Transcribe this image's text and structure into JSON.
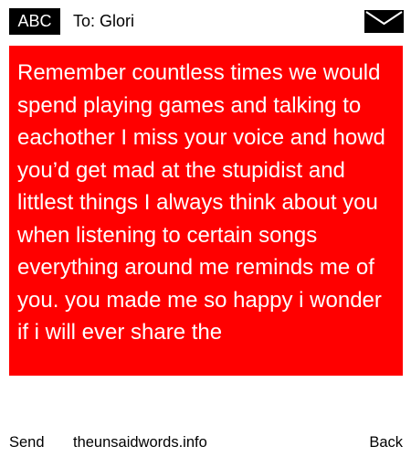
{
  "header": {
    "badge_label": "ABC",
    "recipient": "To: Glori",
    "envelope_icon": "envelope-icon"
  },
  "message": {
    "text": "Remember countless times we would spend playing games and talking to eachother I miss your voice and howd you’d get mad at the stupidist and littlest things I always think about you when listening to certain songs everything around me reminds me of you. you made me so happy i wonder if i will ever share the",
    "background_color": "#ff0000",
    "text_color": "#ffffff"
  },
  "footer": {
    "send_label": "Send",
    "site_label": "theunsaidwords.info",
    "back_label": "Back"
  }
}
